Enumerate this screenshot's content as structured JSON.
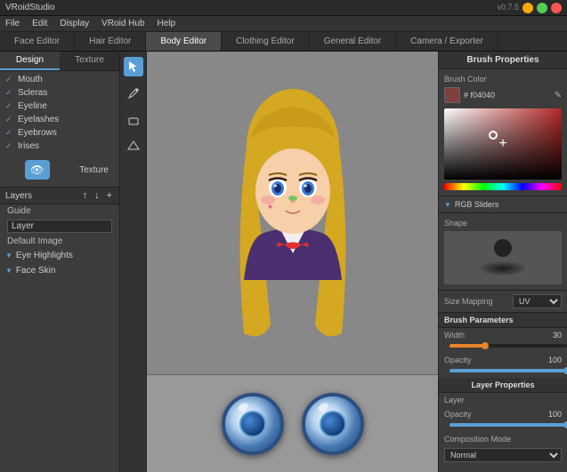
{
  "app": {
    "title": "VRoidStudio",
    "version": "v0.7.5"
  },
  "menu": {
    "items": [
      "File",
      "Edit",
      "Display",
      "VRoid Hub",
      "Help"
    ]
  },
  "tabs": [
    {
      "label": "Face Editor",
      "active": false
    },
    {
      "label": "Hair Editor",
      "active": false
    },
    {
      "label": "Body Editor",
      "active": true
    },
    {
      "label": "Clothing Editor",
      "active": false
    },
    {
      "label": "General Editor",
      "active": false
    },
    {
      "label": "Camera / Exporter",
      "active": false
    }
  ],
  "left_panel": {
    "design_tab": "Design",
    "texture_tab": "Texture",
    "layer_items": [
      {
        "label": "Mouth",
        "checked": true
      },
      {
        "label": "Scleras",
        "checked": true
      },
      {
        "label": "Eyeline",
        "checked": true
      },
      {
        "label": "Eyelashes",
        "checked": true
      },
      {
        "label": "Eyebrows",
        "checked": true
      },
      {
        "label": "Irises",
        "checked": true
      }
    ],
    "texture_label": "Texture",
    "layers_title": "Layers",
    "up_arrow": "↑",
    "down_arrow": "↓",
    "add_btn": "+",
    "layer_sub": {
      "guide": "Guide",
      "layer": "Layer",
      "default_image": "Default Image"
    },
    "expand_items": [
      {
        "label": "Eye Highlights"
      },
      {
        "label": "Face Skin"
      }
    ]
  },
  "tools": {
    "select": "↖",
    "pen": "✏",
    "eraser": "◻",
    "fill": "◇"
  },
  "canvas": {
    "texture_placeholder": ""
  },
  "brush_properties": {
    "panel_title": "Brush Properties",
    "brush_color_label": "Brush Color",
    "color_hex": "# f04040",
    "rgb_sliders": "RGB Sliders",
    "shape_label": "Shape",
    "size_mapping_label": "Size Mapping",
    "size_mapping_value": "UV",
    "brush_params_label": "Brush Parameters",
    "width_label": "Width",
    "width_value": "30",
    "opacity_label": "Opacity",
    "opacity_value": "100",
    "layer_props_label": "Layer Properties",
    "layer_label": "Layer",
    "layer_opacity_label": "Opacity",
    "layer_opacity_value": "100",
    "comp_mode_label": "Composition Mode",
    "comp_mode_value": "Normal"
  }
}
